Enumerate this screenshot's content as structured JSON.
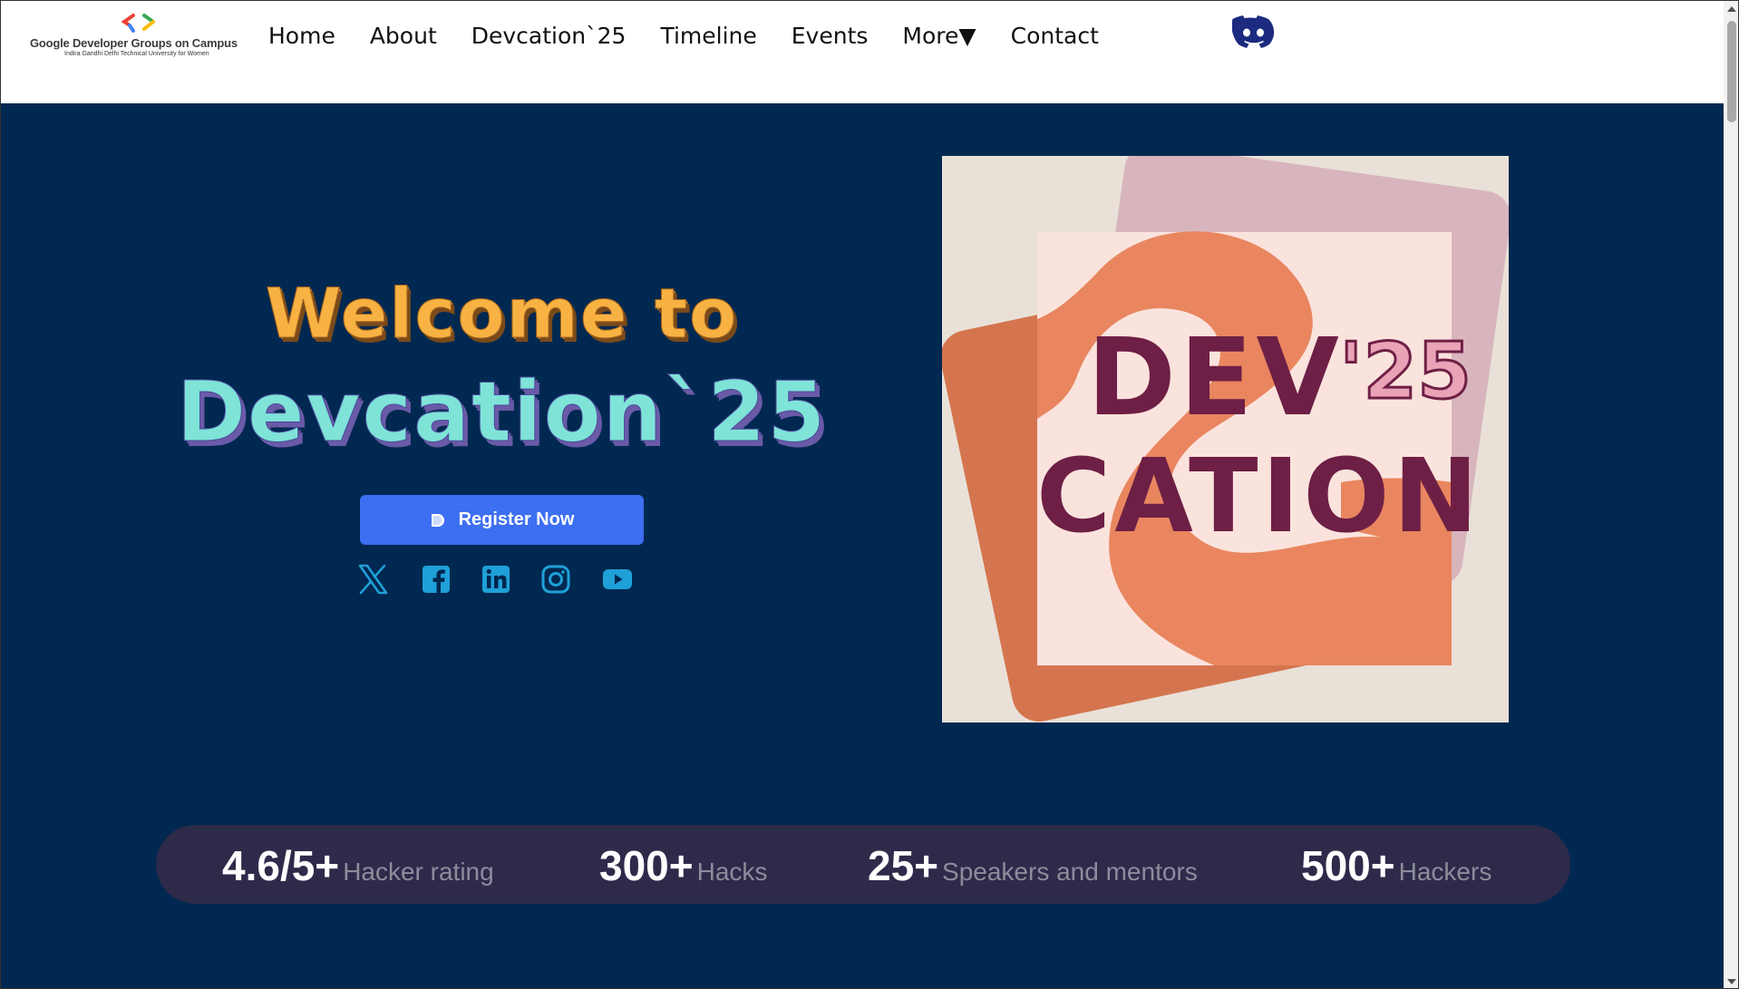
{
  "navbar": {
    "logo": {
      "line1": "Google Developer Groups on Campus",
      "line2": "Indira Gandhi Delhi Technical University for Women",
      "icon": "gdg-brackets-logo"
    },
    "links": [
      "Home",
      "About",
      "Devcation`25",
      "Timeline",
      "Events",
      "More▼",
      "Contact"
    ],
    "discord_icon": "discord-icon"
  },
  "hero": {
    "welcome": "Welcome to",
    "title": "Devcation`25",
    "register_label": "Register Now",
    "register_icon": "devfolio-icon",
    "socials": [
      "x-icon",
      "facebook-icon",
      "linkedin-icon",
      "instagram-icon",
      "youtube-icon"
    ]
  },
  "poster": {
    "line1": "DEV",
    "year": "'25",
    "line2": "CATION"
  },
  "stats": [
    {
      "value": "4.6/5+",
      "label": "Hacker rating"
    },
    {
      "value": "300+",
      "label": "Hacks"
    },
    {
      "value": "25+",
      "label": "Speakers and mentors"
    },
    {
      "value": "500+",
      "label": "Hackers"
    }
  ],
  "colors": {
    "background": "#002850",
    "accent_button": "#3d6ff2",
    "social_icons": "#1fa0d8",
    "welcome_text": "#f7b243",
    "title_text": "#7fe3d8",
    "stats_bar": "#2e2a4a",
    "discord": "#1c2b80"
  }
}
